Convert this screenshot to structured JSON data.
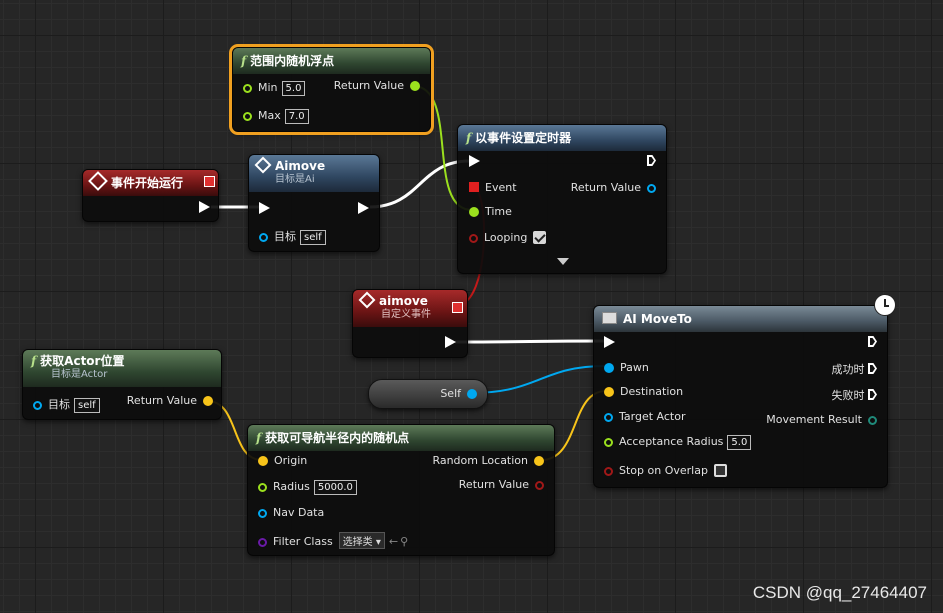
{
  "nodes": {
    "random_float": {
      "title": "范围内随机浮点",
      "min_label": "Min",
      "min_value": "5.0",
      "max_label": "Max",
      "max_value": "7.0",
      "return_label": "Return Value"
    },
    "set_timer": {
      "title": "以事件设置定时器",
      "event_label": "Event",
      "time_label": "Time",
      "looping_label": "Looping",
      "return_label": "Return Value"
    },
    "begin_play": {
      "title": "事件开始运行"
    },
    "aimove_call": {
      "title": "Aimove",
      "subtitle": "目标是Ai",
      "target_label": "目标",
      "target_value": "self"
    },
    "custom_event": {
      "title": "aimove",
      "subtitle": "自定义事件"
    },
    "ai_moveto": {
      "title": "AI MoveTo",
      "pawn_label": "Pawn",
      "destination_label": "Destination",
      "target_actor_label": "Target Actor",
      "acceptance_label": "Acceptance Radius",
      "acceptance_value": "5.0",
      "stop_label": "Stop on Overlap",
      "success_label": "成功时",
      "fail_label": "失败时",
      "movement_result_label": "Movement Result"
    },
    "get_actor_location": {
      "title": "获取Actor位置",
      "subtitle": "目标是Actor",
      "target_label": "目标",
      "target_value": "self",
      "return_label": "Return Value"
    },
    "random_nav_point": {
      "title": "获取可导航半径内的随机点",
      "origin_label": "Origin",
      "radius_label": "Radius",
      "radius_value": "5000.0",
      "nav_data_label": "Nav Data",
      "filter_label": "Filter Class",
      "filter_value": "选择类",
      "random_location_label": "Random Location",
      "return_label": "Return Value"
    },
    "self_ref": {
      "label": "Self"
    }
  },
  "watermark": "CSDN @qq_27464407",
  "colors": {
    "exec": "#ffffff",
    "float_pin": "#9be01e",
    "object_pin": "#00a8f0",
    "vector_pin": "#f8c41a",
    "selection": "#f0a020"
  }
}
